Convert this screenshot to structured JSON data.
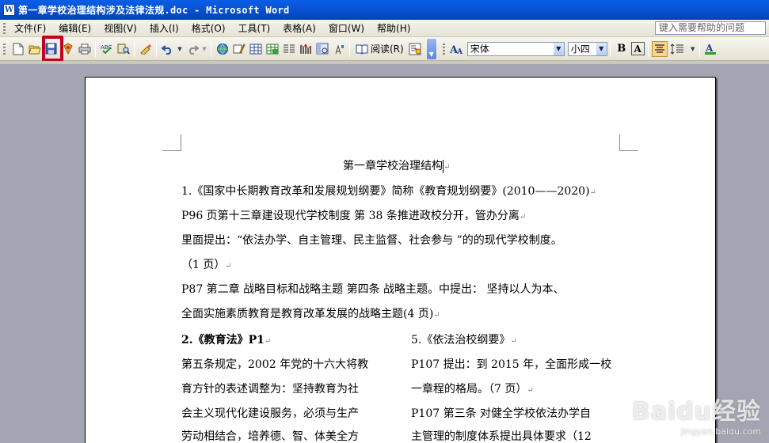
{
  "window": {
    "title": "第一章学校治理结构涉及法律法规.doc - Microsoft Word"
  },
  "menu": {
    "items": [
      "文件(F)",
      "编辑(E)",
      "视图(V)",
      "插入(I)",
      "格式(O)",
      "工具(T)",
      "表格(A)",
      "窗口(W)",
      "帮助(H)"
    ],
    "help_placeholder": "键入需要帮助的问题"
  },
  "toolbar": {
    "read_label": "阅读(R)",
    "font_name": "宋体",
    "font_size": "小四",
    "bold_label": "B",
    "char_border_label": "A",
    "icons": [
      "new-icon",
      "open-icon",
      "save-icon",
      "permission-icon",
      "print-icon",
      "spelling-icon",
      "research-icon",
      "format-painter-icon",
      "undo-icon",
      "redo-icon",
      "hyperlink-icon",
      "tables-borders-icon",
      "insert-table-icon",
      "insert-excel-icon",
      "columns-icon",
      "drawing-icon",
      "document-map-icon",
      "show-hide-icon",
      "zoom-icon",
      "read-icon",
      "styles-icon",
      "align-center-icon",
      "line-spacing-icon",
      "font-color-icon"
    ]
  },
  "document": {
    "title": "第一章学校治理结构",
    "lines": [
      "1.《国家中长期教育改革和发展规划纲要》简称《教育规划纲要》(2010——2020)",
      "P96 页第十三章建设现代学校制度   第 38 条推进政校分开，管办分离",
      "里面提出：“依法办学、自主管理、民主监督、社会参与 ”的的现代学校制度。",
      "（1 页）",
      "P87 第二章  战略目标和战略主题   第四条  战略主题。中提出：  坚持以人为本、",
      "全面实施素质教育是教育改革发展的战略主题(4 页)"
    ],
    "left_col": {
      "heading": "2.《教育法》P1",
      "lines": [
        "第五条规定，2002 年党的十六大将教",
        "育方针的表述调整为：坚持教育为社",
        "会主义现代化建设服务，必须与生产",
        "劳动相结合，培养德、智、体美全方"
      ]
    },
    "right_col": {
      "heading": "5.《依法治校纲要》",
      "lines": [
        "P107 提出：到 2015 年，全面形成一校",
        "一章程的格局。（7 页）",
        "P107 第三条  对健全学校依法办学自",
        "主管理的制度体系提出具体要求（12"
      ]
    }
  },
  "watermark": {
    "brand": "Baidu经验",
    "url": "jingyan.baidu.com"
  }
}
